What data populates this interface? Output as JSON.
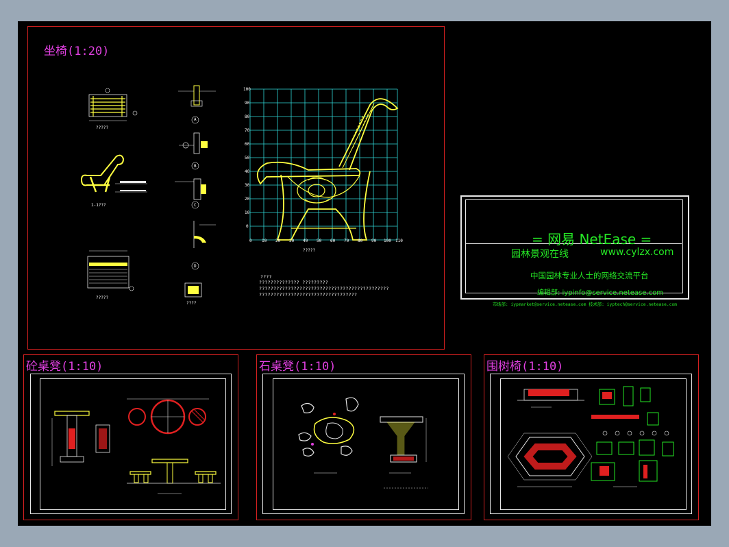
{
  "panels": {
    "bench": {
      "title": "坐椅(1:20)"
    },
    "concrete_table": {
      "title": "砼桌凳(1:10)"
    },
    "stone_table": {
      "title": "石桌凳(1:10)"
    },
    "tree_bench": {
      "title": "围树椅(1:10)"
    }
  },
  "bench_labels": {
    "plan": "?????",
    "side": "1-1???",
    "front": "?????",
    "elevation": "?????",
    "detail_a": "A",
    "detail_b": "B",
    "detail_c": "C",
    "detail_d": "D",
    "detail_e": "????"
  },
  "notes": {
    "heading": "????",
    "line1": "??????????????  ?????????",
    "line2": "?????????????????????????????????????????????",
    "line3": "??????????????????????????????????"
  },
  "grid_axis": {
    "y_ticks": [
      "100",
      "90",
      "80",
      "70",
      "60",
      "50",
      "40",
      "30",
      "20",
      "10",
      "0"
    ],
    "x_ticks": [
      "0",
      "10",
      "20",
      "30",
      "40",
      "50",
      "60",
      "70",
      "80",
      "90",
      "100",
      "110"
    ]
  },
  "netease": {
    "title": "= 网易 NetEase =",
    "subtitle": "园林景观在线",
    "url": "www.cylzx.com",
    "platform": "中国园林专业人士的网络交流平台",
    "editor": "编辑部: iypinfo@service.netease.com",
    "market": "市场部: iypmarket@service.netease.com  技术部: iyptech@service.netease.com"
  },
  "colors": {
    "background": "#000000",
    "frame": "#d42020",
    "title": "#e040e0",
    "drawing": "#ffff40",
    "grid": "#30d8d8",
    "netease": "#25e625",
    "red_fill": "#e02020"
  }
}
